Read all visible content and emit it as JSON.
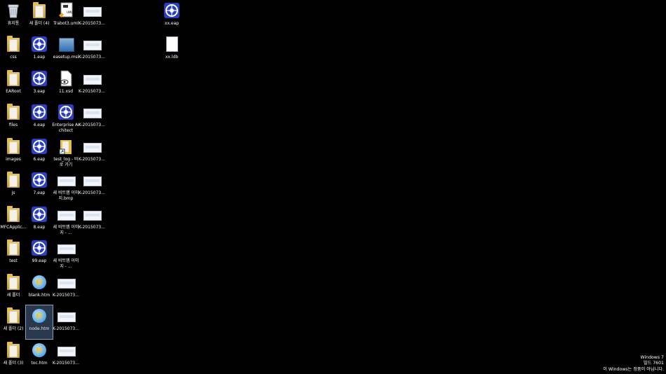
{
  "desktop_icons": [
    {
      "type": "recycle",
      "label": "휴지통"
    },
    {
      "type": "folder",
      "label": "css"
    },
    {
      "type": "folder",
      "label": "EARoot"
    },
    {
      "type": "folder",
      "label": "files"
    },
    {
      "type": "folder",
      "label": "images"
    },
    {
      "type": "folder",
      "label": "js"
    },
    {
      "type": "folder",
      "label": "MFCApplic..."
    },
    {
      "type": "folder",
      "label": "test"
    },
    {
      "type": "folder",
      "label": "새 폴더"
    },
    {
      "type": "folder",
      "label": "새 폴더 (2)"
    },
    {
      "type": "folder",
      "label": "새 폴더 (3)"
    },
    {
      "type": "folder",
      "label": "새 폴더 (4)"
    },
    {
      "type": "ea",
      "label": "1.eap"
    },
    {
      "type": "ea",
      "label": "3.eap"
    },
    {
      "type": "ea",
      "label": "4.eap"
    },
    {
      "type": "ea",
      "label": "6.eap"
    },
    {
      "type": "ea",
      "label": "7.eap"
    },
    {
      "type": "ea",
      "label": "8.eap"
    },
    {
      "type": "ea",
      "label": "99.eap"
    },
    {
      "type": "ie",
      "label": "blank.htm"
    },
    {
      "type": "ie",
      "label": "node.htm",
      "selected": true
    },
    {
      "type": "ie",
      "label": "toc.htm"
    },
    {
      "type": "uml",
      "label": "Trabot3.uml"
    },
    {
      "type": "msi",
      "label": "easetup.msi"
    },
    {
      "type": "xsd",
      "label": "11.xsd"
    },
    {
      "type": "ea",
      "label": "Enterprise Architect"
    },
    {
      "type": "shortcut-folder",
      "label": "test_log - 바로 가기"
    },
    {
      "type": "bmp",
      "label": "새 비트맵 이미지.bmp"
    },
    {
      "type": "bmp",
      "label": "새 비트맵 이미지 - ..."
    },
    {
      "type": "bmp",
      "label": "새 비트맵 이미지 - ..."
    },
    {
      "type": "bmp",
      "label": "K-2015073..."
    },
    {
      "type": "bmp",
      "label": "K-2015073..."
    },
    {
      "type": "bmp",
      "label": "K-2015073..."
    },
    {
      "type": "bmp",
      "label": "K-2015073..."
    },
    {
      "type": "bmp",
      "label": "K-2015073..."
    },
    {
      "type": "bmp",
      "label": "K-2015073..."
    },
    {
      "type": "bmp",
      "label": "K-2015073..."
    },
    {
      "type": "bmp",
      "label": "K-2015073..."
    },
    {
      "type": "bmp",
      "label": "K-2015073..."
    },
    {
      "type": "bmp",
      "label": "K-2015073..."
    },
    {
      "type": "ea",
      "label": "xx.eap"
    },
    {
      "type": "file",
      "label": "xx.ldb"
    }
  ],
  "watermark": {
    "line1": "Windows 7",
    "line2": "빌드 7601",
    "line3": "이 Windows는 정품이 아닙니다."
  }
}
